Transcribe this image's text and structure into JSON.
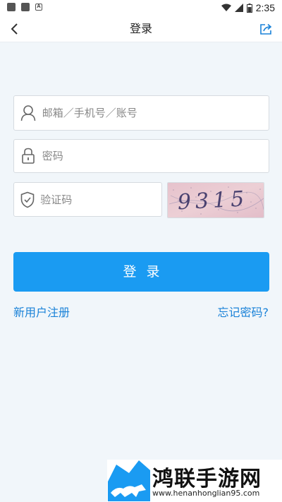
{
  "status_bar": {
    "time": "2:35",
    "badge_letter": "A"
  },
  "header": {
    "title": "登录"
  },
  "form": {
    "account_placeholder": "邮箱／手机号／账号",
    "password_placeholder": "密码",
    "captcha_placeholder": "验证码",
    "captcha_text": "9315"
  },
  "login_button": {
    "label": "登录"
  },
  "links": {
    "register": "新用户注册",
    "forgot_password": "忘记密码?"
  },
  "watermark": {
    "brand": "鸿联手游网",
    "url": "www.henanhonglian95.com"
  },
  "colors": {
    "accent": "#1a9bf2",
    "link": "#1a82d8",
    "background": "#f1f6fa"
  }
}
